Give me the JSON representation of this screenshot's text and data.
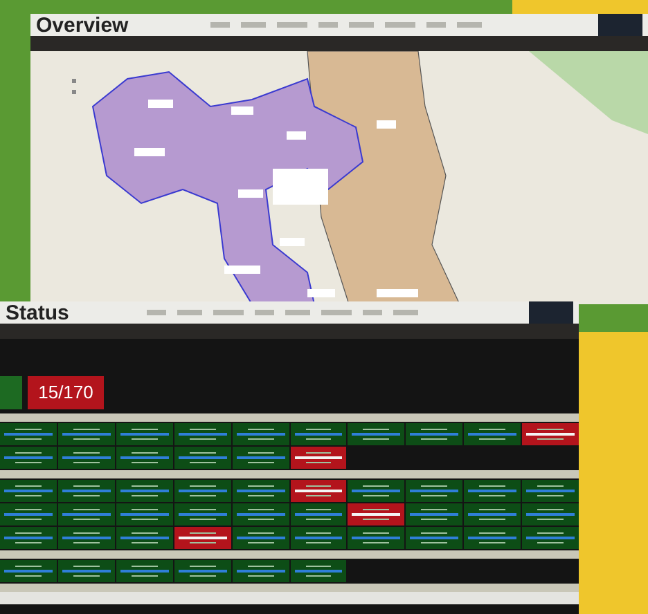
{
  "overview": {
    "title": "Overview"
  },
  "status": {
    "title": "Status",
    "counter": {
      "value": "15/170",
      "alert": true
    },
    "sections": [
      {
        "tiles": [
          {
            "alert": false
          },
          {
            "alert": false
          },
          {
            "alert": false
          },
          {
            "alert": false
          },
          {
            "alert": false
          },
          {
            "alert": false
          },
          {
            "alert": false
          },
          {
            "alert": false
          },
          {
            "alert": false
          },
          {
            "alert": true
          },
          {
            "alert": false
          },
          {
            "alert": false
          },
          {
            "alert": false
          },
          {
            "alert": false
          },
          {
            "alert": false
          },
          {
            "alert": true
          }
        ]
      },
      {
        "tiles": [
          {
            "alert": false
          },
          {
            "alert": false
          },
          {
            "alert": false
          },
          {
            "alert": false
          },
          {
            "alert": false
          },
          {
            "alert": true
          },
          {
            "alert": false
          },
          {
            "alert": false
          },
          {
            "alert": false
          },
          {
            "alert": false
          },
          {
            "alert": false
          },
          {
            "alert": false
          },
          {
            "alert": false
          },
          {
            "alert": false
          },
          {
            "alert": false
          },
          {
            "alert": false
          },
          {
            "alert": true
          },
          {
            "alert": false
          },
          {
            "alert": false
          },
          {
            "alert": false
          },
          {
            "alert": false
          },
          {
            "alert": false
          },
          {
            "alert": false
          },
          {
            "alert": true
          },
          {
            "alert": false
          },
          {
            "alert": false
          },
          {
            "alert": false
          },
          {
            "alert": false
          },
          {
            "alert": false
          },
          {
            "alert": false
          }
        ]
      },
      {
        "tiles": [
          {
            "alert": false
          },
          {
            "alert": false
          },
          {
            "alert": false
          },
          {
            "alert": false
          },
          {
            "alert": false
          },
          {
            "alert": false
          }
        ]
      }
    ]
  }
}
